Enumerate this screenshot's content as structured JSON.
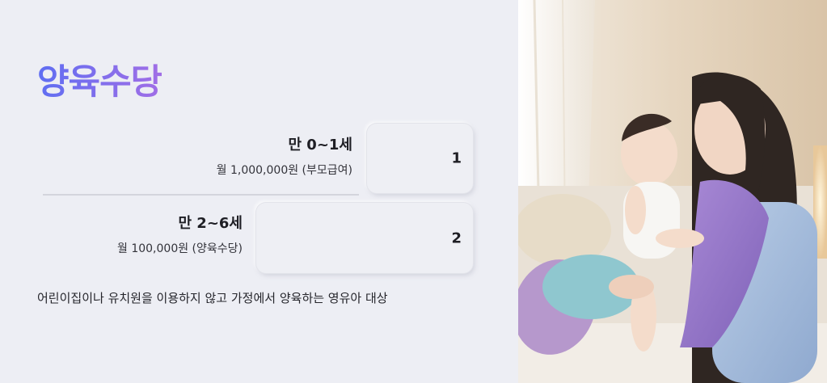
{
  "title": "양육수당",
  "rows": [
    {
      "age": "만 0~1세",
      "amount": "월 1,000,000원 (부모급여)",
      "number": "1"
    },
    {
      "age": "만 2~6세",
      "amount": "월 100,000원 (양육수당)",
      "number": "2"
    }
  ],
  "description": "어린이집이나 유치원을 이용하지 않고 가정에서 양육하는 영유아 대상",
  "colors": {
    "title_gradient_start": "#5f6ef2",
    "title_gradient_end": "#a16ee6",
    "background": "#edeef4"
  }
}
